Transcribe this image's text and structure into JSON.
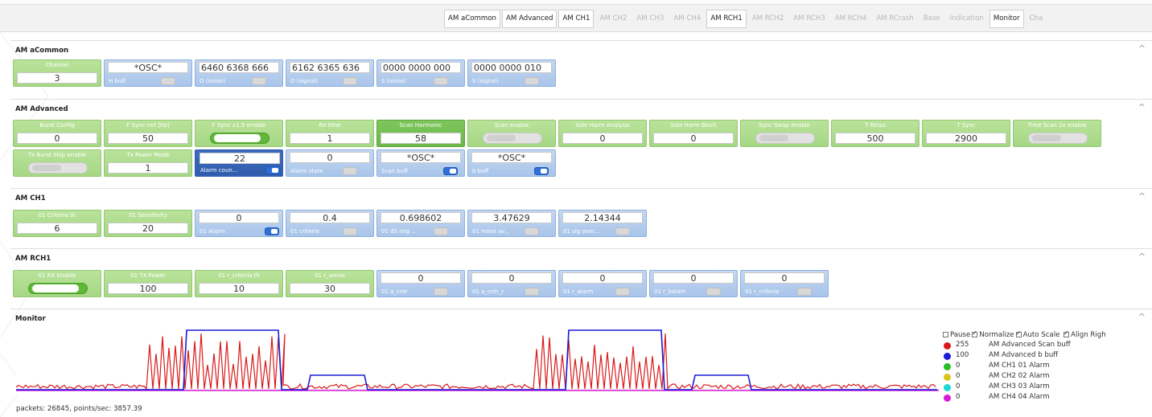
{
  "tabs": [
    {
      "label": "AM aCommon",
      "active": true
    },
    {
      "label": "AM Advanced",
      "active": true
    },
    {
      "label": "AM CH1",
      "active": true
    },
    {
      "label": "AM CH2",
      "active": false
    },
    {
      "label": "AM CH3",
      "active": false
    },
    {
      "label": "AM CH4",
      "active": false
    },
    {
      "label": "AM RCH1",
      "active": true
    },
    {
      "label": "AM RCH2",
      "active": false
    },
    {
      "label": "AM RCH3",
      "active": false
    },
    {
      "label": "AM RCH4",
      "active": false
    },
    {
      "label": "AM RCrash",
      "active": false
    },
    {
      "label": "Base",
      "active": false
    },
    {
      "label": "Indication",
      "active": false
    },
    {
      "label": "Monitor",
      "active": true
    },
    {
      "label": "Cha",
      "active": false
    }
  ],
  "sections": {
    "common": {
      "title": "AM aCommon"
    },
    "advanced": {
      "title": "AM Advanced"
    },
    "ch1": {
      "title": "AM CH1"
    },
    "rch1": {
      "title": "AM RCH1"
    },
    "monitor": {
      "title": "Monitor"
    }
  },
  "collapse_icon": "^",
  "common": {
    "channel": {
      "label": "Channel",
      "value": "3"
    },
    "h_buff": {
      "value": "*OSC*",
      "label": "H buff"
    },
    "o_noise": {
      "value": "6460 6368 666",
      "label": "O (noise)"
    },
    "o_signal": {
      "value": "6162 6365 636",
      "label": "O (signal)"
    },
    "s_noise": {
      "value": "0000 0000 000",
      "label": "S (noise)"
    },
    "s_signal": {
      "value": "0000 0000 010",
      "label": "S (signal)"
    }
  },
  "advanced": {
    "burst_config": {
      "label": "Burst Config",
      "value": "0"
    },
    "f_sync_net": {
      "label": "F Sync net [Hz]",
      "value": "50"
    },
    "f_sync_x15": {
      "label": "F Sync x1.5 enable"
    },
    "rx_time": {
      "label": "Rx time",
      "value": "1"
    },
    "scan_harmonic": {
      "label": "Scan Harmonic",
      "value": "58"
    },
    "scan_enable": {
      "label": "Scan enable"
    },
    "side_harm_analysis": {
      "label": "Side Harm Analysis",
      "value": "0"
    },
    "side_harm_block": {
      "label": "Side Harm Block",
      "value": "0"
    },
    "sync_swap": {
      "label": "Sync Swap enable"
    },
    "t_relax": {
      "label": "T Relax",
      "value": "500"
    },
    "t_sync": {
      "label": "T Sync",
      "value": "2900"
    },
    "time_scan_2x": {
      "label": "Time Scan 2x enable"
    },
    "tx_burst_skip": {
      "label": "Tx Burst Skip enable"
    },
    "tx_power_mode": {
      "label": "Tx Power Mode",
      "value": "1"
    },
    "alarm_count": {
      "value": "22",
      "label": "Alarm coun..."
    },
    "alarm_state": {
      "value": "0",
      "label": "Alarm state"
    },
    "scan_buff": {
      "value": "*OSC*",
      "label": "Scan buff"
    },
    "b_buff": {
      "value": "*OSC*",
      "label": "b buff"
    }
  },
  "ch1": {
    "criteria_th": {
      "label": "01 Criteria th",
      "value": "6"
    },
    "sensitivity": {
      "label": "01 Sensitivity",
      "value": "20"
    },
    "alarm": {
      "value": "0",
      "label": "01 Alarm"
    },
    "criteria": {
      "value": "0.4",
      "label": "01 criteria"
    },
    "ds_sig": {
      "value": "0.698602",
      "label": "01 dS (sig ..."
    },
    "noise_av": {
      "value": "3.47629",
      "label": "01 noise av..."
    },
    "sig_aver": {
      "value": "2.14344",
      "label": "01 sig aver..."
    }
  },
  "rch1": {
    "rx_enable": {
      "label": "01 RX Enable"
    },
    "tx_power": {
      "label": "01 TX Power",
      "value": "100"
    },
    "r_criteria_th": {
      "label": "01 r_criteria th",
      "value": "10"
    },
    "r_sense": {
      "label": "01 r_sense",
      "value": "30"
    },
    "a_cntr": {
      "value": "0",
      "label": "01 a_cntr"
    },
    "a_cntr_r": {
      "value": "0",
      "label": "01 a_cntr_r"
    },
    "r_alarm": {
      "value": "0",
      "label": "01 r_alarm"
    },
    "r_bstam": {
      "value": "0",
      "label": "01 r_bstam"
    },
    "r_criteria": {
      "value": "0",
      "label": "01 r_criteria"
    }
  },
  "monitor": {
    "options": {
      "pause": "Pause",
      "normalize": "Normalize",
      "auto_scale": "Auto Scale",
      "align_right": "Align Righ"
    },
    "legend": [
      {
        "value": "255",
        "name": "AM Advanced Scan buff",
        "color": "#d91a1a"
      },
      {
        "value": "100",
        "name": "AM Advanced b buff",
        "color": "#1a1ad9"
      },
      {
        "value": "0",
        "name": "AM CH1 01 Alarm",
        "color": "#22c022"
      },
      {
        "value": "0",
        "name": "AM CH2 02 Alarm",
        "color": "#d9c41a"
      },
      {
        "value": "0",
        "name": "AM CH3 03 Alarm",
        "color": "#1ad9d9"
      },
      {
        "value": "0",
        "name": "AM CH4 04 Alarm",
        "color": "#d91ad9"
      }
    ],
    "status": "packets: 26845, points/sec: 3857.39"
  }
}
